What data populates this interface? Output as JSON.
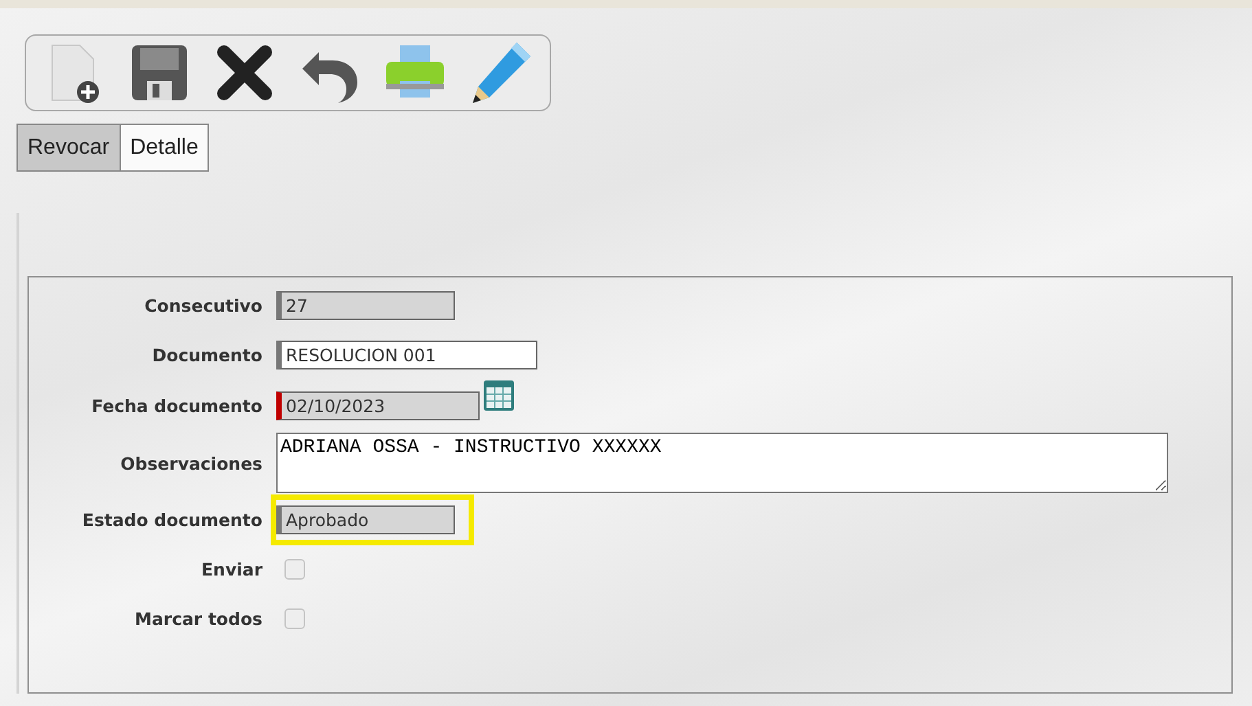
{
  "toolbar": [
    {
      "kind": "new"
    },
    {
      "kind": "save"
    },
    {
      "kind": "delete"
    },
    {
      "kind": "undo"
    },
    {
      "kind": "print"
    },
    {
      "kind": "edit"
    }
  ],
  "tabs": [
    {
      "label": "Revocar",
      "selected": true
    },
    {
      "label": "Detalle",
      "selected": false
    }
  ],
  "form": [
    {
      "kind": "text",
      "label": "Consecutivo",
      "value": "27",
      "readonly": true,
      "required": false,
      "highlighted": false
    },
    {
      "kind": "text",
      "label": "Documento",
      "value": "RESOLUCION 001",
      "readonly": false,
      "required": false,
      "highlighted": false
    },
    {
      "kind": "date",
      "label": "Fecha documento",
      "value": "02/10/2023",
      "readonly": true,
      "required": true,
      "highlighted": false
    },
    {
      "kind": "textarea",
      "label": "Observaciones",
      "value": "ADRIANA OSSA - INSTRUCTIVO XXXXXX"
    },
    {
      "kind": "text",
      "label": "Estado documento",
      "value": "Aprobado",
      "readonly": true,
      "required": false,
      "highlighted": true
    },
    {
      "kind": "checkbox",
      "label": "Enviar",
      "checked": false
    },
    {
      "kind": "checkbox",
      "label": "Marcar todos",
      "checked": false
    }
  ]
}
